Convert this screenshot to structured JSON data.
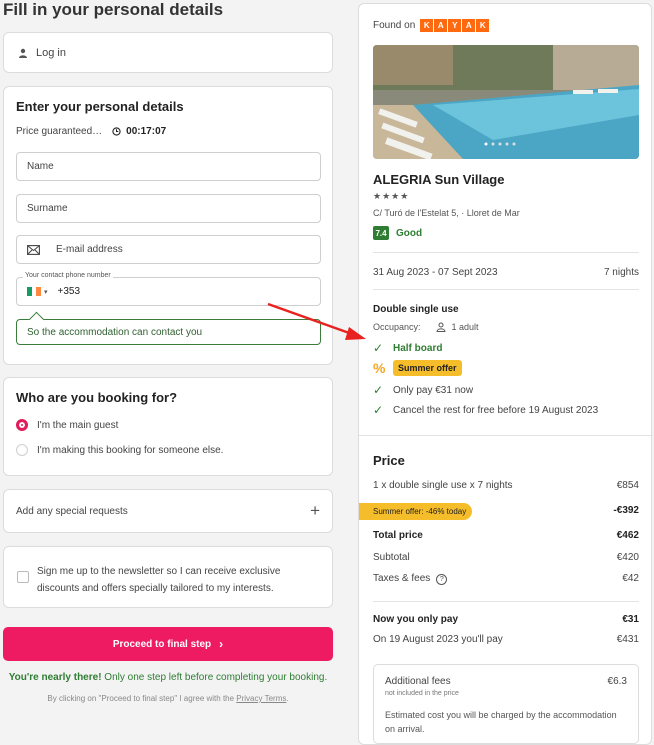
{
  "page": {
    "title": "Fill in your personal details"
  },
  "login": {
    "label": "Log in"
  },
  "details": {
    "heading": "Enter your personal details",
    "price_guaranteed": "Price guaranteed…",
    "timer": "00:17:07",
    "name_placeholder": "Name",
    "surname_placeholder": "Surname",
    "email_placeholder": "E-mail address",
    "phone_label": "Your contact phone number",
    "phone_code": "+353",
    "phone_hint": "So the accommodation can contact you"
  },
  "booking_for": {
    "heading": "Who are you booking for?",
    "options": [
      {
        "label": "I'm the main guest",
        "selected": true
      },
      {
        "label": "I'm making this booking for someone else.",
        "selected": false
      }
    ]
  },
  "requests": {
    "label": "Add any special requests",
    "icon": "plus-icon"
  },
  "newsletter": {
    "text": "Sign me up to the newsletter so I can receive exclusive discounts and offers specially tailored to my interests."
  },
  "proceed": {
    "label": "Proceed to final step"
  },
  "footer": {
    "nearly_bold": "You're nearly there!",
    "nearly_rest": " Only one step left before completing your booking.",
    "agree_prefix": "By clicking on \"Proceed to final step\" I agree with the ",
    "agree_link": "Privacy Terms",
    "agree_suffix": "."
  },
  "summary": {
    "found_on": "Found on",
    "kayak_letters": [
      "K",
      "A",
      "Y",
      "A",
      "K"
    ],
    "hotel_name": "ALEGRIA Sun Village",
    "stars": "★★★★",
    "address": "C/ Turó de l'Estelat 5, · Lloret de Mar",
    "rating_score": "7.4",
    "rating_label": "Good",
    "dates": "31 Aug 2023 - 07 Sept 2023",
    "nights": "7 nights",
    "room": "Double single use",
    "occupancy_label": "Occupancy:",
    "occupancy_value": "1 adult",
    "features": {
      "board": "Half board",
      "offer": "Summer offer",
      "pay_now": "Only pay €31 now",
      "cancel": "Cancel the rest for free before 19 August 2023"
    }
  },
  "price": {
    "heading": "Price",
    "base_label": "1 x double single use x 7 nights",
    "base_value": "€854",
    "discount_label": "Summer offer: -46% today",
    "discount_value": "-€392",
    "total_label": "Total price",
    "total_value": "€462",
    "subtotal_label": "Subtotal",
    "subtotal_value": "€420",
    "taxes_label": "Taxes & fees",
    "taxes_value": "€42",
    "now_label": "Now you only pay",
    "now_value": "€31",
    "later_label": "On 19 August 2023 you'll pay",
    "later_value": "€431",
    "fees_title": "Additional fees",
    "fees_sub": "not included in the price",
    "fees_value": "€6.3",
    "fees_desc": "Estimated cost you will be charged by the accommodation on arrival."
  },
  "colors": {
    "accent": "#ee1b63",
    "green": "#2f7d32",
    "offer": "#f5bd2a",
    "kayak": "#ff690f",
    "arrow": "#e8221f"
  }
}
